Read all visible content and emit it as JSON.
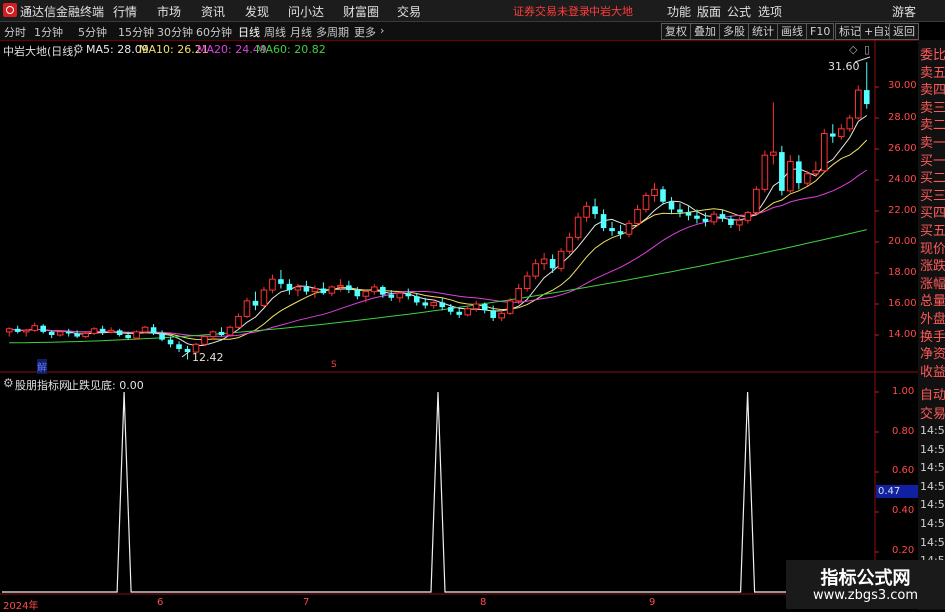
{
  "app": {
    "title": "通达信金融终端",
    "menu": [
      "行情",
      "市场",
      "资讯",
      "发现",
      "问小达",
      "财富圈",
      "交易"
    ],
    "status_login": "证券交易未登录",
    "status_stock": "中岩大地",
    "right_menu": [
      "功能",
      "版面",
      "公式",
      "选项"
    ],
    "user": "游客"
  },
  "toolbar": {
    "periods": [
      "分时",
      "1分钟",
      "5分钟",
      "15分钟",
      "30分钟",
      "60分钟",
      "日线",
      "周线",
      "月线",
      "多周期",
      "更多"
    ],
    "active_period": "日线",
    "more_arrow": "chevron-right-icon",
    "buttons": [
      "复权",
      "叠加",
      "多股",
      "统计",
      "画线",
      "F10",
      "标记",
      "+自选",
      "返回"
    ]
  },
  "main_chart": {
    "stock_title": "中岩大地(日线)",
    "ma": [
      {
        "label": "MA5: 28.09",
        "color": "#e8e8e8"
      },
      {
        "label": "MA10: 26.21",
        "color": "#f0e060"
      },
      {
        "label": "MA20: 24.49",
        "color": "#e040e0"
      },
      {
        "label": "MA60: 20.82",
        "color": "#40d040"
      }
    ],
    "high_label": "31.60",
    "low_label": "12.42",
    "marker_jie": "解",
    "marker_s": "S",
    "y_ticks": [
      "30.00",
      "28.00",
      "26.00",
      "24.00",
      "22.00",
      "20.00",
      "18.00",
      "16.00",
      "14.00"
    ]
  },
  "indicator": {
    "name": "股朋指标网",
    "series_label": "止跌见底: 0.00",
    "y_ticks": [
      "1.00",
      "0.80",
      "0.60",
      "0.40",
      "0.20"
    ],
    "current_value": "0.47"
  },
  "x_axis": {
    "labels": [
      "2024年",
      "6",
      "7",
      "8",
      "9"
    ]
  },
  "right_panel": {
    "labels": [
      "委比",
      "卖五",
      "卖四",
      "卖三",
      "卖二",
      "卖一",
      "买一",
      "买二",
      "买三",
      "买四",
      "买五",
      "现价",
      "涨跌",
      "涨幅",
      "总量",
      "外盘",
      "换手",
      "净资",
      "收益"
    ],
    "bottom_labels": [
      "自动",
      "交易"
    ],
    "times": [
      "14:56",
      "14:56",
      "14:56",
      "14:56",
      "14:56",
      "14:56",
      "14:56",
      "14:56"
    ]
  },
  "watermark": {
    "title": "指标公式网",
    "url": "www.zbgs3.com"
  },
  "chart_data": {
    "type": "candlestick",
    "ylim": [
      12.0,
      32.0
    ],
    "candles": [
      [
        14.2,
        14.5,
        13.9,
        14.4
      ],
      [
        14.4,
        14.6,
        14.1,
        14.2
      ],
      [
        14.2,
        14.4,
        13.9,
        14.3
      ],
      [
        14.3,
        14.8,
        14.2,
        14.6
      ],
      [
        14.6,
        14.7,
        14.1,
        14.2
      ],
      [
        14.2,
        14.3,
        13.8,
        14.0
      ],
      [
        14.0,
        14.3,
        13.9,
        14.2
      ],
      [
        14.2,
        14.4,
        13.9,
        14.1
      ],
      [
        14.1,
        14.3,
        13.8,
        13.9
      ],
      [
        13.9,
        14.2,
        13.8,
        14.1
      ],
      [
        14.1,
        14.5,
        14.0,
        14.4
      ],
      [
        14.4,
        14.6,
        14.0,
        14.2
      ],
      [
        14.2,
        14.5,
        14.1,
        14.3
      ],
      [
        14.3,
        14.4,
        13.9,
        14.0
      ],
      [
        14.0,
        14.2,
        13.7,
        13.8
      ],
      [
        13.8,
        14.3,
        13.7,
        14.2
      ],
      [
        14.2,
        14.6,
        14.1,
        14.5
      ],
      [
        14.5,
        14.7,
        14.0,
        14.1
      ],
      [
        14.1,
        14.3,
        13.6,
        13.7
      ],
      [
        13.7,
        13.9,
        13.2,
        13.4
      ],
      [
        13.4,
        13.6,
        12.9,
        13.1
      ],
      [
        13.1,
        13.3,
        12.42,
        12.9
      ],
      [
        12.9,
        13.5,
        12.8,
        13.4
      ],
      [
        13.4,
        14.0,
        13.3,
        13.9
      ],
      [
        13.9,
        14.3,
        13.7,
        14.2
      ],
      [
        14.2,
        14.5,
        13.9,
        14.0
      ],
      [
        14.0,
        14.6,
        13.9,
        14.5
      ],
      [
        14.5,
        15.4,
        14.4,
        15.2
      ],
      [
        15.2,
        16.4,
        15.1,
        16.2
      ],
      [
        16.2,
        16.8,
        15.6,
        15.9
      ],
      [
        15.9,
        17.1,
        15.8,
        16.9
      ],
      [
        16.9,
        17.9,
        16.7,
        17.6
      ],
      [
        17.6,
        18.2,
        17.0,
        17.3
      ],
      [
        17.3,
        17.6,
        16.6,
        16.9
      ],
      [
        16.9,
        17.3,
        16.5,
        17.1
      ],
      [
        17.1,
        17.5,
        16.6,
        16.8
      ],
      [
        16.8,
        17.2,
        16.4,
        17.0
      ],
      [
        17.0,
        17.4,
        16.6,
        16.7
      ],
      [
        16.7,
        17.2,
        16.5,
        17.1
      ],
      [
        17.1,
        17.6,
        16.8,
        17.2
      ],
      [
        17.2,
        17.5,
        16.7,
        16.9
      ],
      [
        16.9,
        17.1,
        16.3,
        16.5
      ],
      [
        16.5,
        16.9,
        16.1,
        16.8
      ],
      [
        16.8,
        17.3,
        16.6,
        17.1
      ],
      [
        17.1,
        17.2,
        16.4,
        16.6
      ],
      [
        16.6,
        16.9,
        16.2,
        16.4
      ],
      [
        16.4,
        16.8,
        16.1,
        16.7
      ],
      [
        16.7,
        17.0,
        16.3,
        16.5
      ],
      [
        16.5,
        16.7,
        15.9,
        16.1
      ],
      [
        16.1,
        16.4,
        15.7,
        15.9
      ],
      [
        15.9,
        16.3,
        15.7,
        16.1
      ],
      [
        16.1,
        16.4,
        15.6,
        15.8
      ],
      [
        15.8,
        16.0,
        15.3,
        15.5
      ],
      [
        15.5,
        15.8,
        15.1,
        15.3
      ],
      [
        15.3,
        15.9,
        15.2,
        15.7
      ],
      [
        15.7,
        16.2,
        15.5,
        16.0
      ],
      [
        16.0,
        16.1,
        15.4,
        15.6
      ],
      [
        15.6,
        15.9,
        14.9,
        15.1
      ],
      [
        15.1,
        15.6,
        14.9,
        15.4
      ],
      [
        15.4,
        16.4,
        15.3,
        16.2
      ],
      [
        16.2,
        17.3,
        16.0,
        17.0
      ],
      [
        17.0,
        18.1,
        16.8,
        17.8
      ],
      [
        17.8,
        18.9,
        17.6,
        18.6
      ],
      [
        18.6,
        19.3,
        18.2,
        18.9
      ],
      [
        18.9,
        19.2,
        18.0,
        18.3
      ],
      [
        18.3,
        19.6,
        18.1,
        19.4
      ],
      [
        19.4,
        20.6,
        19.2,
        20.3
      ],
      [
        20.3,
        21.9,
        20.1,
        21.6
      ],
      [
        21.6,
        22.6,
        21.3,
        22.3
      ],
      [
        22.3,
        22.8,
        21.5,
        21.8
      ],
      [
        21.8,
        22.1,
        20.7,
        20.9
      ],
      [
        20.9,
        21.3,
        20.4,
        20.7
      ],
      [
        20.7,
        21.1,
        20.2,
        20.5
      ],
      [
        20.5,
        21.4,
        20.3,
        21.2
      ],
      [
        21.2,
        22.4,
        21.0,
        22.1
      ],
      [
        22.1,
        23.2,
        21.9,
        23.0
      ],
      [
        23.0,
        23.8,
        22.6,
        23.4
      ],
      [
        23.4,
        23.6,
        22.4,
        22.6
      ],
      [
        22.6,
        22.9,
        21.8,
        22.1
      ],
      [
        22.1,
        22.5,
        21.6,
        21.9
      ],
      [
        21.9,
        22.3,
        21.4,
        21.7
      ],
      [
        21.7,
        22.1,
        21.2,
        21.5
      ],
      [
        21.5,
        21.9,
        21.0,
        21.3
      ],
      [
        21.3,
        22.0,
        21.1,
        21.8
      ],
      [
        21.8,
        22.1,
        21.3,
        21.5
      ],
      [
        21.5,
        21.7,
        20.9,
        21.1
      ],
      [
        21.1,
        21.6,
        20.7,
        21.4
      ],
      [
        21.4,
        22.0,
        21.2,
        21.9
      ],
      [
        21.9,
        23.6,
        21.8,
        23.4
      ],
      [
        23.4,
        25.9,
        23.2,
        25.6
      ],
      [
        25.6,
        29.0,
        25.0,
        25.8
      ],
      [
        25.8,
        26.2,
        23.0,
        23.3
      ],
      [
        23.3,
        25.6,
        23.1,
        25.2
      ],
      [
        25.2,
        25.6,
        23.4,
        23.8
      ],
      [
        23.8,
        24.6,
        23.6,
        24.4
      ],
      [
        24.4,
        25.2,
        24.2,
        24.6
      ],
      [
        24.6,
        27.3,
        24.5,
        27.0
      ],
      [
        27.0,
        27.6,
        26.4,
        26.8
      ],
      [
        26.8,
        27.6,
        26.6,
        27.3
      ],
      [
        27.3,
        28.2,
        27.1,
        28.0
      ],
      [
        28.0,
        30.1,
        27.9,
        29.8
      ],
      [
        29.8,
        31.6,
        28.6,
        28.9
      ]
    ],
    "indicator_peaks": [
      0.14,
      0.5,
      0.855
    ]
  }
}
